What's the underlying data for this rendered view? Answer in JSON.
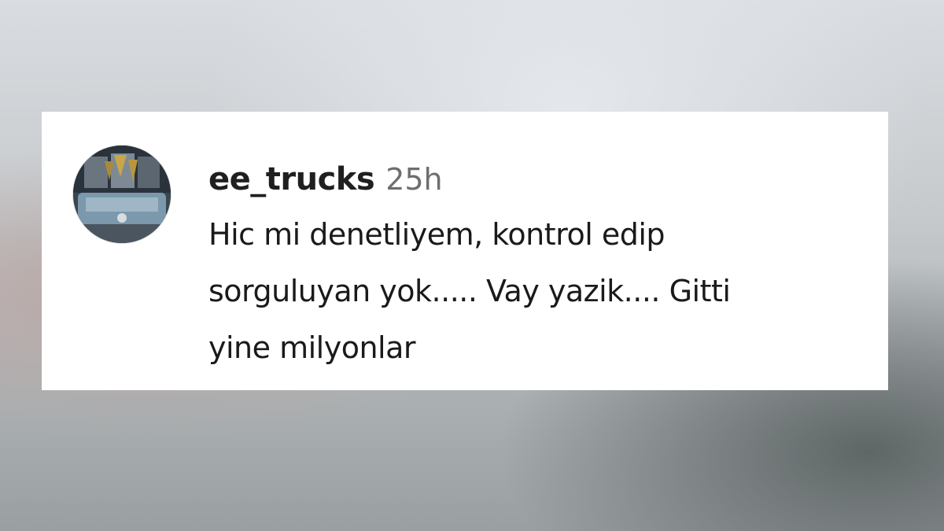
{
  "comment": {
    "username": "ee_trucks",
    "timestamp": "25h",
    "text_lines": [
      "Hic mi denetliyem, kontrol edip",
      "sorguluyan yok..... Vay yazik.... Gitti",
      "yine milyonlar"
    ],
    "avatar_icon": "truck-photo-avatar"
  },
  "colors": {
    "card_background": "#ffffff",
    "username": "#1f1f1f",
    "timestamp": "#6e6e6e",
    "text": "#1a1a1a"
  }
}
